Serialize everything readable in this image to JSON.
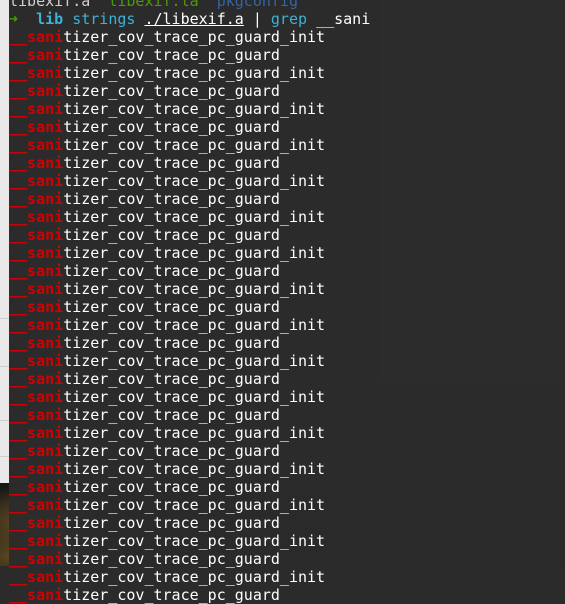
{
  "previous_output": {
    "files": [
      {
        "name": "libexif.a",
        "kind": "file"
      },
      {
        "name": "libexif.la",
        "kind": "executable"
      },
      {
        "name": "pkgconfig",
        "kind": "directory"
      }
    ]
  },
  "prompt": {
    "arrow": "➜",
    "cwd": "lib",
    "command": "strings",
    "argument": "./libexif.a",
    "pipe": "|",
    "grep": "grep",
    "pattern": "__sani"
  },
  "match_highlight": "__sani",
  "output_lines": [
    "tizer_cov_trace_pc_guard_init",
    "tizer_cov_trace_pc_guard",
    "tizer_cov_trace_pc_guard_init",
    "tizer_cov_trace_pc_guard",
    "tizer_cov_trace_pc_guard_init",
    "tizer_cov_trace_pc_guard",
    "tizer_cov_trace_pc_guard_init",
    "tizer_cov_trace_pc_guard",
    "tizer_cov_trace_pc_guard_init",
    "tizer_cov_trace_pc_guard",
    "tizer_cov_trace_pc_guard_init",
    "tizer_cov_trace_pc_guard",
    "tizer_cov_trace_pc_guard_init",
    "tizer_cov_trace_pc_guard",
    "tizer_cov_trace_pc_guard_init",
    "tizer_cov_trace_pc_guard",
    "tizer_cov_trace_pc_guard_init",
    "tizer_cov_trace_pc_guard",
    "tizer_cov_trace_pc_guard_init",
    "tizer_cov_trace_pc_guard",
    "tizer_cov_trace_pc_guard_init",
    "tizer_cov_trace_pc_guard",
    "tizer_cov_trace_pc_guard_init",
    "tizer_cov_trace_pc_guard",
    "tizer_cov_trace_pc_guard_init",
    "tizer_cov_trace_pc_guard",
    "tizer_cov_trace_pc_guard_init",
    "tizer_cov_trace_pc_guard",
    "tizer_cov_trace_pc_guard_init",
    "tizer_cov_trace_pc_guard",
    "tizer_cov_trace_pc_guard_init",
    "tizer_cov_trace_pc_guard"
  ],
  "colors": {
    "terminal_bg": "#2c2c2c",
    "match": "#d40000",
    "prompt_arrow": "#4e9a06",
    "prompt_cwd": "#3bb2d6",
    "text": "#ffffff"
  }
}
